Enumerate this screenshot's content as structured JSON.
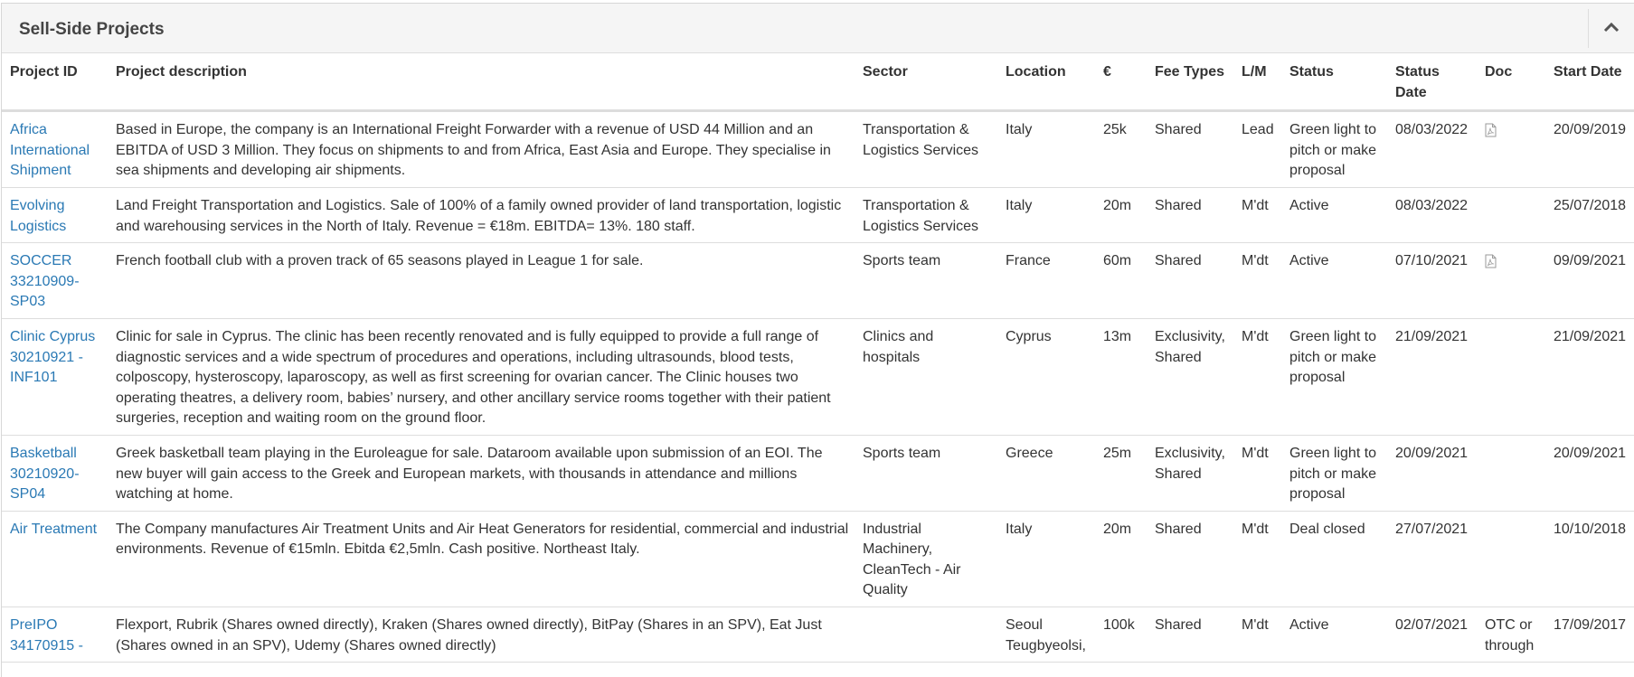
{
  "panel": {
    "title": "Sell-Side Projects",
    "collapse_icon": "chevron-up-icon"
  },
  "table": {
    "columns": [
      "Project ID",
      "Project description",
      "Sector",
      "Location",
      "€",
      "Fee Types",
      "L/M",
      "Status",
      "Status Date",
      "Doc",
      "Start Date"
    ],
    "rows": [
      {
        "id": "Africa International Shipment",
        "description": "Based in Europe, the company is an International Freight Forwarder with a revenue of USD 44 Million and an EBITDA of USD 3 Million. They focus on shipments to and from Africa, East Asia and Europe. They specialise in sea shipments and developing air shipments.",
        "sector": "Transportation & Logistics Services",
        "location": "Italy",
        "amount": "25k",
        "fee_types": "Shared",
        "lm": "Lead",
        "status": "Green light to pitch or make proposal",
        "status_date": "08/03/2022",
        "doc": "pdf-icon",
        "start_date": "20/09/2019"
      },
      {
        "id": "Evolving Logistics",
        "description": "Land Freight Transportation and Logistics. Sale of 100% of a family owned provider of land transportation, logistic and warehousing services in the North of Italy. Revenue = €18m. EBITDA= 13%. 180 staff.",
        "sector": "Transportation & Logistics Services",
        "location": "Italy",
        "amount": "20m",
        "fee_types": "Shared",
        "lm": "M'dt",
        "status": "Active",
        "status_date": "08/03/2022",
        "doc": "",
        "start_date": "25/07/2018"
      },
      {
        "id": "SOCCER 33210909-SP03",
        "description": "French football club with a proven track of 65 seasons played in League 1 for sale.",
        "sector": "Sports team",
        "location": "France",
        "amount": "60m",
        "fee_types": "Shared",
        "lm": "M'dt",
        "status": "Active",
        "status_date": "07/10/2021",
        "doc": "pdf-icon",
        "start_date": "09/09/2021"
      },
      {
        "id": "Clinic Cyprus 30210921 - INF101",
        "description": "Clinic for sale in Cyprus. The clinic has been recently renovated and is fully equipped to provide a full range of diagnostic services and a wide spectrum of procedures and operations, including ultrasounds, blood tests, colposcopy, hysteroscopy, laparoscopy, as well as first screening for ovarian cancer. The Clinic houses two operating theatres, a delivery room, babies’ nursery, and other ancillary service rooms together with their patient surgeries, reception and waiting room on the ground floor.",
        "sector": "Clinics and hospitals",
        "location": "Cyprus",
        "amount": "13m",
        "fee_types": "Exclusivity, Shared",
        "lm": "M'dt",
        "status": "Green light to pitch or make proposal",
        "status_date": "21/09/2021",
        "doc": "",
        "start_date": "21/09/2021"
      },
      {
        "id": "Basketball 30210920-SP04",
        "description": "Greek basketball team playing in the Euroleague for sale. Dataroom available upon submission of an EOI. The new buyer will gain access to the Greek and European markets, with thousands in attendance and millions watching at home.",
        "sector": "Sports team",
        "location": "Greece",
        "amount": "25m",
        "fee_types": "Exclusivity, Shared",
        "lm": "M'dt",
        "status": "Green light to pitch or make proposal",
        "status_date": "20/09/2021",
        "doc": "",
        "start_date": "20/09/2021"
      },
      {
        "id": "Air Treatment",
        "description": "The Company manufactures Air Treatment Units and Air Heat Generators for residential, commercial and industrial environments. Revenue of €15mln. Ebitda €2,5mln. Cash positive. Northeast Italy.",
        "sector": "Industrial Machinery, CleanTech - Air Quality",
        "location": "Italy",
        "amount": "20m",
        "fee_types": "Shared",
        "lm": "M'dt",
        "status": "Deal closed",
        "status_date": "27/07/2021",
        "doc": "",
        "start_date": "10/10/2018"
      },
      {
        "id": "PreIPO 34170915 -",
        "description": "Flexport, Rubrik (Shares owned directly), Kraken (Shares owned directly), BitPay (Shares in an SPV), Eat Just (Shares owned in an SPV), Udemy (Shares owned directly)",
        "sector": "",
        "location": "Seoul Teugbyeolsi,",
        "amount": "100k",
        "fee_types": "Shared",
        "lm": "M'dt",
        "status": "Active",
        "status_date": "02/07/2021",
        "doc": "OTC or through",
        "start_date": "17/09/2017"
      }
    ]
  }
}
